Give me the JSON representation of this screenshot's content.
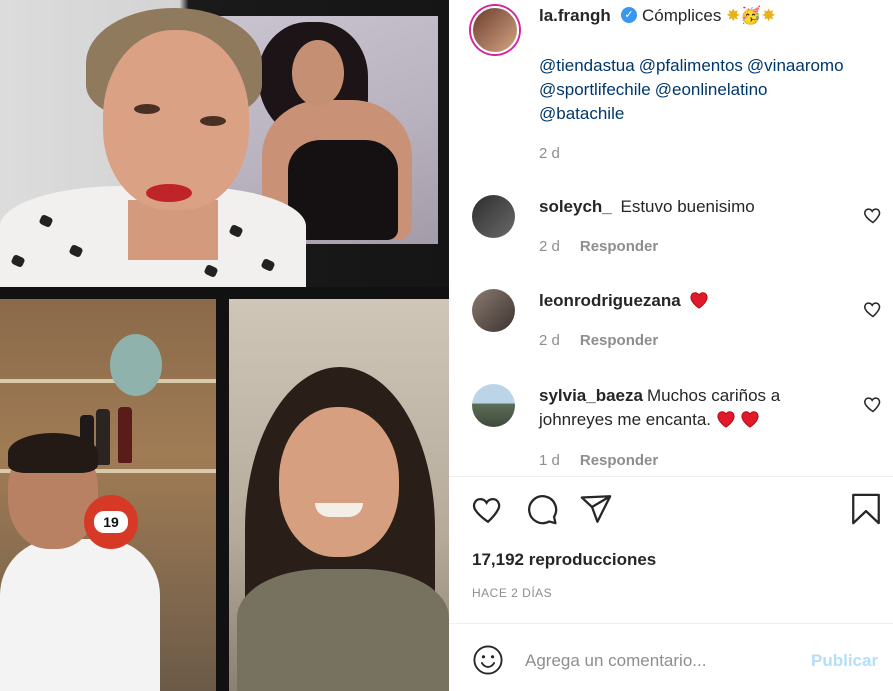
{
  "post": {
    "username": "la.frangh",
    "caption": "Cómplices",
    "caption_emoji": "✸🥳✸",
    "mentions": [
      "@tiendastua",
      "@pfalimentos",
      "@vinaaromo",
      "@sportlifechile",
      "@eonlinelatino",
      "@batachile"
    ],
    "caption_time": "2 d"
  },
  "comments": [
    {
      "username": "soleych_",
      "text": "Estuvo buenisimo",
      "hearts": 0,
      "time": "2 d",
      "reply": "Responder"
    },
    {
      "username": "leonrodriguezana",
      "text": "",
      "hearts": 1,
      "time": "2 d",
      "reply": "Responder"
    },
    {
      "username": "sylvia_baeza",
      "text": "Muchos cariños a johnreyes me encanta.",
      "hearts": 2,
      "time": "1 d",
      "reply": "Responder"
    }
  ],
  "stats": {
    "views": "17,192 reproducciones",
    "posted": "HACE 2 DÍAS"
  },
  "composer": {
    "placeholder": "Agrega un comentario...",
    "publish": "Publicar"
  },
  "media": {
    "jersey_number": "19"
  },
  "colors": {
    "mention": "#00376b",
    "meta": "#8e8e8e",
    "like_red": "#ed4956",
    "publish_disabled": "#b2dffc"
  }
}
